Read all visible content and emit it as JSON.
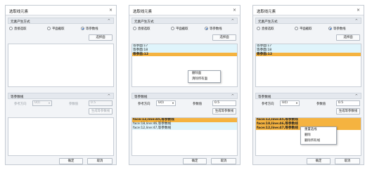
{
  "dialogs": [
    {
      "title": "选取线元素",
      "close": "×",
      "gen_section": "元素产生方式",
      "radios": [
        "直接选取",
        "平面截取",
        "等参数线"
      ],
      "pick_button": "选择面",
      "list": [],
      "isoline_section": "等参数线",
      "dir_label": "参考方向",
      "dir_value": "U(I)",
      "param_label": "参数值",
      "param_value": "0.5",
      "gen_button": "生成等参数线",
      "results": [],
      "ok": "确定",
      "cancel": "取消"
    },
    {
      "title": "选取线元素",
      "close": "×",
      "gen_section": "元素产生方式",
      "radios": [
        "直接选取",
        "平面截取",
        "等参数线"
      ],
      "pick_button": "选择面",
      "list": [
        "等参面:17",
        "等参面:18",
        "等参面:12"
      ],
      "menu": [
        "删除面",
        "清除所有面"
      ],
      "isoline_section": "等参数线",
      "dir_label": "参考方向",
      "dir_value": "U(I)",
      "param_label": "参数值",
      "param_value": "0.5",
      "gen_button": "生成等参数线",
      "results": [
        "face:12,line:45,等参数线",
        "face:18,line:46,等参数线",
        "face:12,line:47,等参数线"
      ],
      "ok": "确定",
      "cancel": "取消"
    },
    {
      "title": "选取线元素",
      "close": "×",
      "gen_section": "元素产生方式",
      "radios": [
        "直接选取",
        "平面截取",
        "等参数线"
      ],
      "pick_button": "选择面",
      "list": [
        "等参面:17",
        "等参面:18",
        "等参面:12"
      ],
      "isoline_section": "等参数线",
      "dir_label": "参考方向",
      "dir_value": "U(I)",
      "param_label": "参数值",
      "param_value": "0.5",
      "gen_button": "生成等参数线",
      "results": [
        "face:12,line:45,等参数线",
        "face:18,line:46,等参数线",
        "face:12,line:47,等参数线"
      ],
      "menu": [
        "重置选线",
        "删除",
        "删除所有线"
      ],
      "ok": "确定",
      "cancel": "取消"
    }
  ],
  "colors": {
    "selected_row": "#f5b340",
    "cyan_row": "#dff4fb",
    "radio_accent": "#3a7bd5"
  }
}
